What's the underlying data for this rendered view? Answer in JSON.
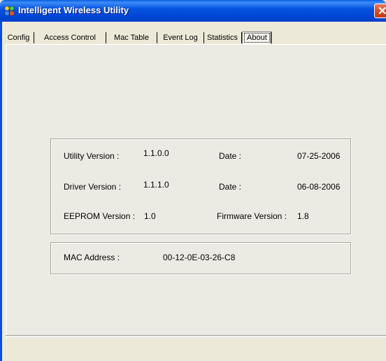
{
  "window": {
    "title": "Intelligent Wireless Utility"
  },
  "tabs": [
    "Config",
    "Access Control",
    "Mac Table",
    "Event Log",
    "Statistics",
    "About"
  ],
  "active_tab": "About",
  "about": {
    "utility_version_label": "Utility Version :",
    "utility_version": "1.1.0.0",
    "utility_date_label": "Date :",
    "utility_date": "07-25-2006",
    "driver_version_label": "Driver Version :",
    "driver_version": "1.1.1.0",
    "driver_date_label": "Date :",
    "driver_date": "06-08-2006",
    "eeprom_version_label": "EEPROM Version :",
    "eeprom_version": "1.0",
    "firmware_version_label": "Firmware Version :",
    "firmware_version": "1.8",
    "mac_address_label": "MAC Address :",
    "mac_address": "00-12-0E-03-26-C8"
  }
}
